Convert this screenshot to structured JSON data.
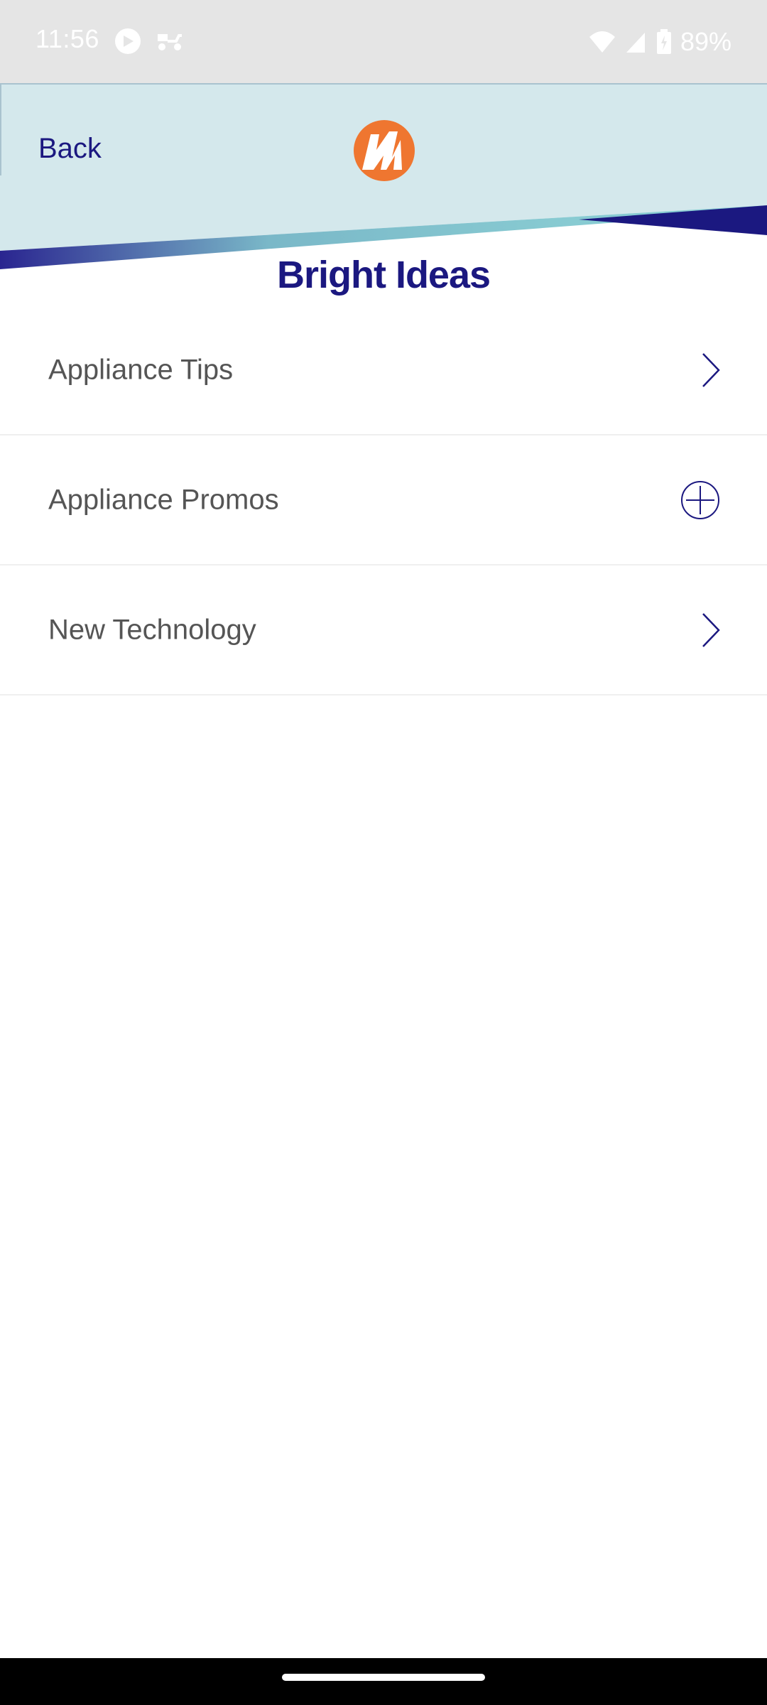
{
  "status_bar": {
    "time": "11:56",
    "battery": "89%"
  },
  "header": {
    "back_label": "Back"
  },
  "page": {
    "title": "Bright Ideas"
  },
  "list": {
    "items": [
      {
        "label": "Appliance Tips",
        "icon": "chevron-right-icon"
      },
      {
        "label": "Appliance Promos",
        "icon": "plus-circle-icon"
      },
      {
        "label": "New Technology",
        "icon": "chevron-right-icon"
      }
    ]
  },
  "colors": {
    "brand_navy": "#1b1880",
    "header_bg": "#d4e8ec",
    "logo_orange": "#ef7630",
    "teal_stripe": "#86c9d0"
  }
}
